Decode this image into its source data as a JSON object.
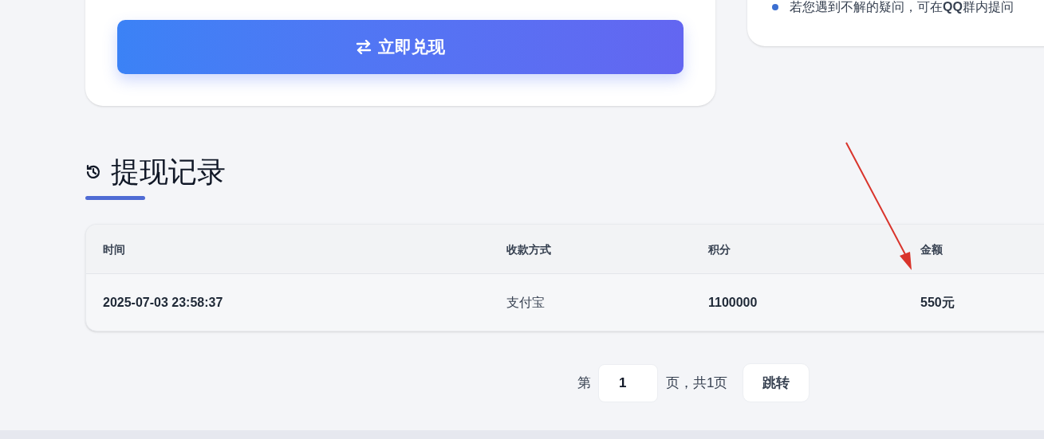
{
  "exchange_card": {
    "button": "立即兑现"
  },
  "tips_card": {
    "items": [
      "若您遇到不解的疑问，可在**QQ**群内提问"
    ]
  },
  "records": {
    "title": "提现记录",
    "table": {
      "columns": [
        "时间",
        "收款方式",
        "积分",
        "金额"
      ],
      "rows": [
        [
          "2025-07-03 23:58:37",
          "支付宝",
          "1100000",
          "550元"
        ]
      ]
    }
  },
  "pagination": {
    "prefix": "第",
    "page": "1",
    "suffix": "页，共1页",
    "button": "跳转"
  }
}
